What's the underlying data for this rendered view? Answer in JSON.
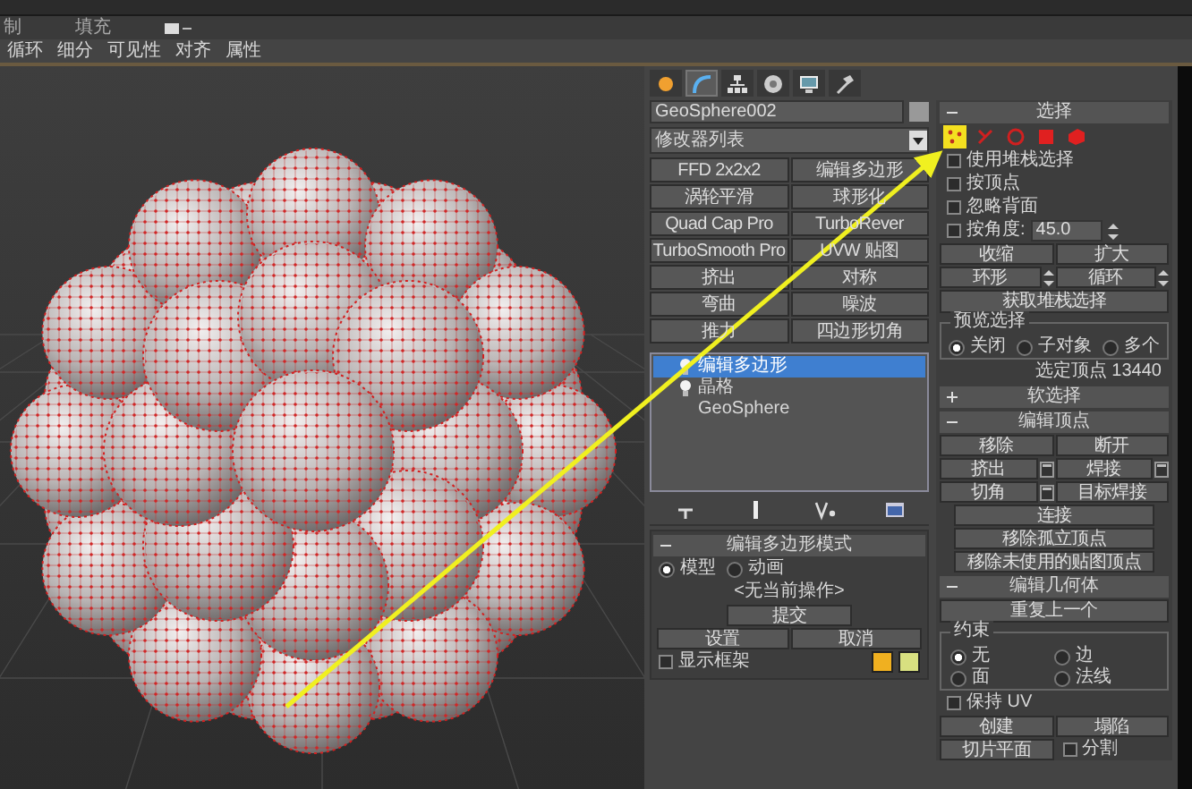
{
  "ribbon": {
    "tabs": [
      {
        "label": "制"
      },
      {
        "label": "填充"
      }
    ],
    "items": [
      "循环",
      "细分",
      "可见性",
      "对齐",
      "属性"
    ]
  },
  "command_tabs": [
    {
      "kind": "create",
      "selected": false
    },
    {
      "kind": "modify",
      "selected": true
    },
    {
      "kind": "hierarchy",
      "selected": false
    },
    {
      "kind": "motion",
      "selected": false
    },
    {
      "kind": "display",
      "selected": false
    },
    {
      "kind": "utilities",
      "selected": false
    }
  ],
  "modifier_panel": {
    "object_name": "GeoSphere002",
    "modifier_list": "修改器列表",
    "buttons": [
      "FFD 2x2x2",
      "编辑多边形",
      "涡轮平滑",
      "球形化",
      "Quad Cap Pro",
      "TurboRever",
      "TurboSmooth Pro",
      "UVW 贴图",
      "挤出",
      "对称",
      "弯曲",
      "噪波",
      "推力",
      "四边形切角"
    ],
    "stack": [
      {
        "label": "编辑多边形",
        "kind": "modifier",
        "selected": true
      },
      {
        "label": "晶格",
        "kind": "modifier",
        "selected": false
      },
      {
        "label": "GeoSphere",
        "kind": "base",
        "selected": false
      }
    ]
  },
  "edit_poly_mode": {
    "title": "编辑多边形模式",
    "expanded": true,
    "modes": [
      {
        "label": "模型",
        "selected": true
      },
      {
        "label": "动画",
        "selected": false
      }
    ],
    "current_op": "<无当前操作>",
    "commit": "提交",
    "settings": "设置",
    "cancel": "取消",
    "show_cage": {
      "label": "显示框架",
      "checked": false
    },
    "cage_colors": [
      {
        "color": "#f0b020"
      },
      {
        "color": "#d8e080"
      }
    ]
  },
  "selection": {
    "title": "选择",
    "expanded": true,
    "subobjects": [
      {
        "kind": "vertex",
        "selected": true
      },
      {
        "kind": "edge",
        "selected": false
      },
      {
        "kind": "border",
        "selected": false
      },
      {
        "kind": "polygon",
        "selected": false
      },
      {
        "kind": "element",
        "selected": false
      }
    ],
    "options": [
      {
        "label": "使用堆栈选择",
        "checked": false
      },
      {
        "label": "按顶点",
        "checked": false
      },
      {
        "label": "忽略背面",
        "checked": false
      }
    ],
    "angle": {
      "label": "按角度:",
      "checked": false,
      "value": "45.0"
    },
    "shrink": "收缩",
    "grow": "扩大",
    "ring": "环形",
    "loop": "循环",
    "get_stack": "获取堆栈选择",
    "preview": {
      "title": "预览选择",
      "options": [
        {
          "label": "关闭",
          "selected": true
        },
        {
          "label": "子对象",
          "selected": false
        },
        {
          "label": "多个",
          "selected": false
        }
      ]
    },
    "status": "选定顶点 13440"
  },
  "soft_selection": {
    "title": "软选择",
    "expanded": false
  },
  "edit_vertices": {
    "title": "编辑顶点",
    "expanded": true,
    "buttons": [
      {
        "label": "移除",
        "kind": "half",
        "has_settings": false
      },
      {
        "label": "断开",
        "kind": "half",
        "has_settings": false
      },
      {
        "label": "挤出",
        "kind": "half",
        "has_settings": true
      },
      {
        "label": "焊接",
        "kind": "half",
        "has_settings": true
      },
      {
        "label": "切角",
        "kind": "half",
        "has_settings": true
      },
      {
        "label": "目标焊接",
        "kind": "half",
        "has_settings": false
      },
      {
        "label": "连接",
        "kind": "full",
        "has_settings": false
      },
      {
        "label": "移除孤立顶点",
        "kind": "full",
        "has_settings": false
      },
      {
        "label": "移除未使用的贴图顶点",
        "kind": "full",
        "has_settings": false
      }
    ]
  },
  "edit_geometry": {
    "title": "编辑几何体",
    "expanded": true,
    "repeat_last": "重复上一个",
    "constraints": {
      "title": "约束",
      "options": [
        {
          "label": "无",
          "selected": true
        },
        {
          "label": "边",
          "selected": false
        },
        {
          "label": "面",
          "selected": false
        },
        {
          "label": "法线",
          "selected": false
        }
      ]
    },
    "preserve_uv": {
      "label": "保持 UV",
      "checked": false
    },
    "create": "创建",
    "collapse": "塌陷",
    "slice_plane": "切片平面",
    "split": {
      "label": "分割",
      "checked": false
    }
  }
}
